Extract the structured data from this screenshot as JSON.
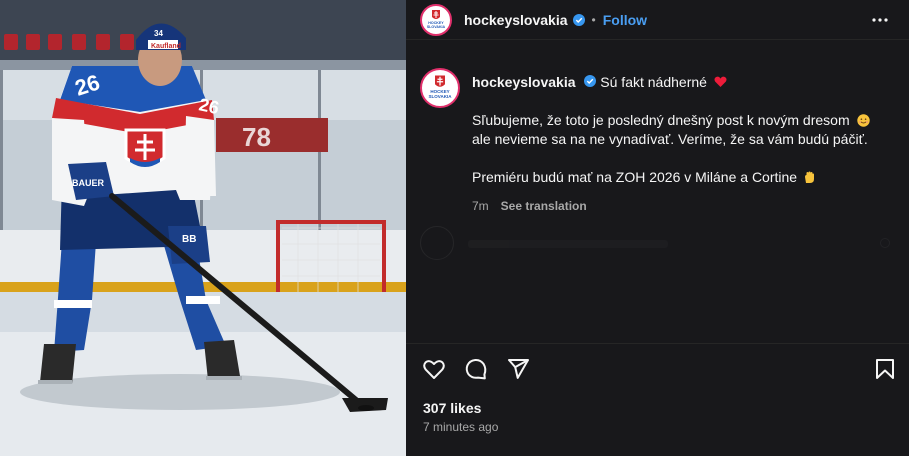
{
  "post": {
    "username": "hockeyslovakia",
    "follow_label": "Follow",
    "separator": "•",
    "caption_first": "Sú fakt nádherné",
    "caption_line1": "Sľubujeme, že toto je posledný dnešný post k novým dresom",
    "caption_line2": "ale nevieme sa na ne vynadívať. Veríme, že sa vám budú páčiť.",
    "caption_line3": "Premiéru budú mať na ZOH 2026 v Miláne a Cortine",
    "age": "7m",
    "see_translation": "See translation",
    "likes": "307 likes",
    "posted_ago": "7 minutes ago"
  },
  "photo": {
    "jersey_number": "26",
    "helmet_number": "34",
    "helmet_sponsor": "Kaufland",
    "stick_brand": "BAUER",
    "glove_brand": "BB",
    "board_digits": "78"
  },
  "logo": {
    "line1": "HOCKEY",
    "line2": "SLOVAKIA"
  },
  "colors": {
    "accent": "#4a9ef2",
    "panel": "#18181b",
    "heart": "#ed1c3a"
  },
  "icons": [
    "verified-badge-icon",
    "more-options-icon",
    "heart-emoji-icon",
    "smiling-emoji-icon",
    "hand-emoji-icon",
    "like-icon",
    "comment-icon",
    "share-icon",
    "save-icon"
  ]
}
